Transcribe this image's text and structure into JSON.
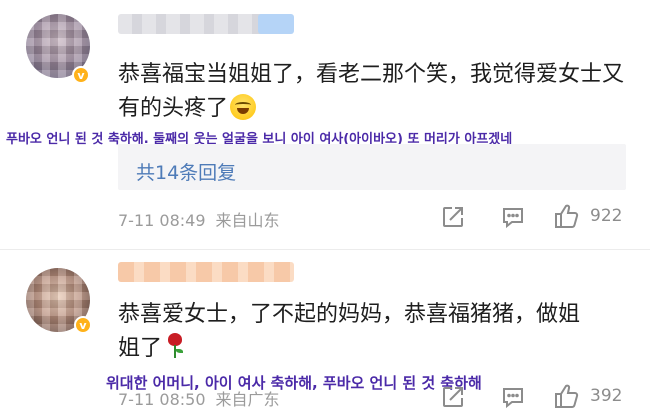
{
  "comments": [
    {
      "text": "恭喜福宝当姐姐了，看老二那个笑，我觉得爱女士又有的头疼了",
      "caption": "푸바오 언니 된 것 축하해. 둘째의 웃는 얼굴을 보니 아이 여사(아이바오) 또 머리가 아프겠네",
      "replies_link": "共14条回复",
      "time": "7-11 08:49",
      "location": "来自山东",
      "likes": "922",
      "badge": "v"
    },
    {
      "text": "恭喜爱女士，了不起的妈妈，恭喜福猪猪，做姐姐了",
      "caption": "위대한 어머니, 아이 여사 축하해, 푸바오 언니 된 것 축하해",
      "time": "7-11 08:50",
      "location": "来自广东",
      "likes": "392",
      "badge": "v"
    }
  ],
  "colors": {
    "link": "#4e7bb8",
    "caption": "#4b2aa8",
    "badge": "#ffb21a",
    "meta": "#9b9b9b"
  },
  "icons": [
    "share-icon",
    "comment-icon",
    "thumbs-up-icon",
    "laughing-emoji-icon",
    "rose-icon",
    "verified-badge-icon"
  ]
}
